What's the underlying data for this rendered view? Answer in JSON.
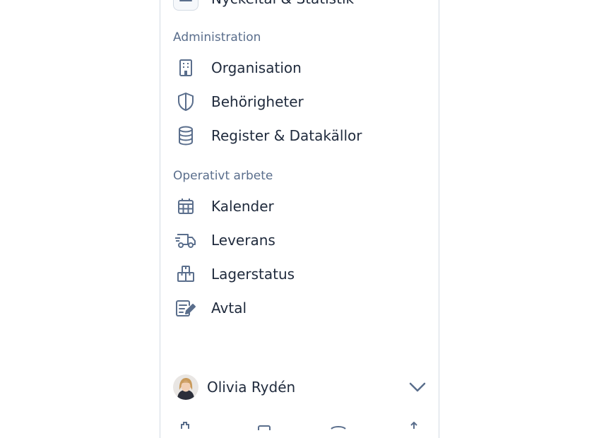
{
  "nav": {
    "top_item": {
      "label": "Nyckeltal & Statistik",
      "icon": "chart-icon"
    },
    "sections": [
      {
        "title": "Administration",
        "items": [
          {
            "label": "Organisation",
            "icon": "building-icon"
          },
          {
            "label": "Behörigheter",
            "icon": "shield-icon"
          },
          {
            "label": "Register & Datakällor",
            "icon": "database-icon"
          }
        ]
      },
      {
        "title": "Operativt arbete",
        "items": [
          {
            "label": "Kalender",
            "icon": "calendar-icon"
          },
          {
            "label": "Leverans",
            "icon": "truck-icon"
          },
          {
            "label": "Lagerstatus",
            "icon": "boxes-icon"
          },
          {
            "label": "Avtal",
            "icon": "contract-icon"
          }
        ]
      }
    ]
  },
  "user": {
    "name": "Olivia Rydén"
  },
  "colors": {
    "icon": "#5a6e8c",
    "text": "#1f2a3c",
    "border": "#d3dae3"
  }
}
